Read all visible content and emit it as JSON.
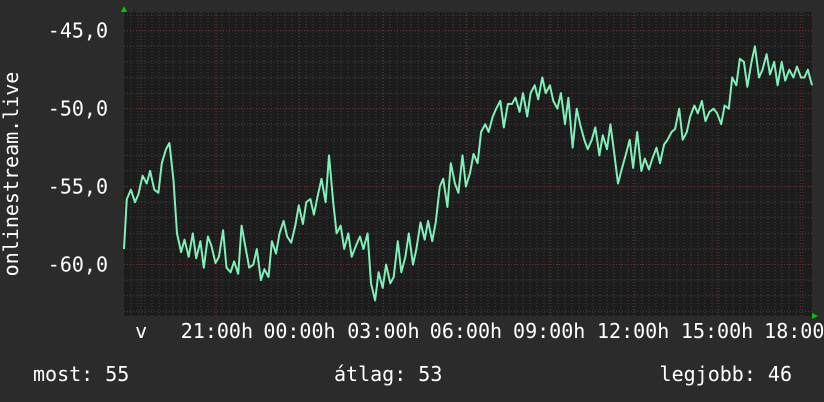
{
  "colors": {
    "background": "#2b2b2b",
    "plot_background": "#1c1c1c",
    "line": "#7ff0b8",
    "grid_minor": "#3e3e3e",
    "grid_major": "#7a2a2a",
    "axis_arrow": "#00c800"
  },
  "stats": {
    "now_label": "most:",
    "now_value": "55",
    "avg_label": "átlag:",
    "avg_value": "53",
    "best_label": "legjobb:",
    "best_value": "46"
  },
  "chart_data": {
    "type": "line",
    "ylabel": "onlinestream.live",
    "ylim": [
      -63.3,
      -43.8
    ],
    "yticks": [
      -45,
      -50,
      -55,
      -60
    ],
    "ytick_labels": [
      "-45,0",
      "-50,0",
      "-55,0",
      "-60,0"
    ],
    "xlim": [
      0,
      100
    ],
    "x_tick_labels": [
      {
        "x": 2.5,
        "label": "v"
      },
      {
        "x": 13.5,
        "label": "21:00h"
      },
      {
        "x": 25.5,
        "label": "00:00h"
      },
      {
        "x": 37.7,
        "label": "03:00h"
      },
      {
        "x": 49.7,
        "label": "06:00h"
      },
      {
        "x": 61.8,
        "label": "09:00h"
      },
      {
        "x": 74.0,
        "label": "12:00h"
      },
      {
        "x": 86.2,
        "label": "15:00h"
      },
      {
        "x": 98.3,
        "label": "18:00h"
      }
    ],
    "grid": true,
    "series": [
      {
        "values": [
          [
            0.0,
            -59.0
          ],
          [
            0.4,
            -55.8
          ],
          [
            1.0,
            -55.2
          ],
          [
            1.6,
            -56.0
          ],
          [
            2.1,
            -55.5
          ],
          [
            2.7,
            -54.3
          ],
          [
            3.3,
            -54.8
          ],
          [
            3.8,
            -54.0
          ],
          [
            4.4,
            -55.2
          ],
          [
            5.0,
            -55.4
          ],
          [
            5.5,
            -53.5
          ],
          [
            6.1,
            -52.6
          ],
          [
            6.6,
            -52.2
          ],
          [
            7.2,
            -54.6
          ],
          [
            7.7,
            -58.0
          ],
          [
            8.3,
            -59.2
          ],
          [
            8.8,
            -58.4
          ],
          [
            9.4,
            -59.5
          ],
          [
            10.0,
            -58.0
          ],
          [
            10.5,
            -59.6
          ],
          [
            11.1,
            -58.5
          ],
          [
            11.6,
            -60.2
          ],
          [
            12.2,
            -58.2
          ],
          [
            12.7,
            -58.8
          ],
          [
            13.3,
            -59.9
          ],
          [
            13.8,
            -59.5
          ],
          [
            14.4,
            -57.8
          ],
          [
            14.9,
            -60.2
          ],
          [
            15.5,
            -60.5
          ],
          [
            16.0,
            -59.8
          ],
          [
            16.6,
            -60.6
          ],
          [
            17.1,
            -57.5
          ],
          [
            17.7,
            -59.0
          ],
          [
            18.2,
            -60.2
          ],
          [
            18.8,
            -60.0
          ],
          [
            19.3,
            -59.0
          ],
          [
            19.9,
            -61.0
          ],
          [
            20.4,
            -60.3
          ],
          [
            21.0,
            -60.8
          ],
          [
            21.5,
            -58.5
          ],
          [
            22.1,
            -59.3
          ],
          [
            22.6,
            -58.0
          ],
          [
            23.2,
            -57.2
          ],
          [
            23.7,
            -58.2
          ],
          [
            24.3,
            -58.6
          ],
          [
            24.9,
            -57.5
          ],
          [
            25.4,
            -56.2
          ],
          [
            26.0,
            -57.4
          ],
          [
            26.5,
            -56.0
          ],
          [
            27.1,
            -55.8
          ],
          [
            27.6,
            -56.8
          ],
          [
            28.2,
            -55.5
          ],
          [
            28.7,
            -54.5
          ],
          [
            29.3,
            -56.0
          ],
          [
            29.8,
            -53.0
          ],
          [
            30.4,
            -56.0
          ],
          [
            30.9,
            -58.0
          ],
          [
            31.5,
            -57.5
          ],
          [
            32.0,
            -59.0
          ],
          [
            32.6,
            -58.0
          ],
          [
            33.1,
            -59.5
          ],
          [
            33.7,
            -58.8
          ],
          [
            34.3,
            -58.2
          ],
          [
            34.8,
            -59.0
          ],
          [
            35.4,
            -58.0
          ],
          [
            35.9,
            -61.2
          ],
          [
            36.5,
            -62.3
          ],
          [
            37.0,
            -60.5
          ],
          [
            37.6,
            -61.5
          ],
          [
            38.1,
            -60.0
          ],
          [
            38.7,
            -61.2
          ],
          [
            39.2,
            -60.8
          ],
          [
            39.8,
            -58.5
          ],
          [
            40.3,
            -60.5
          ],
          [
            40.9,
            -59.5
          ],
          [
            41.4,
            -58.0
          ],
          [
            42.0,
            -60.0
          ],
          [
            42.5,
            -59.0
          ],
          [
            43.1,
            -57.3
          ],
          [
            43.7,
            -58.4
          ],
          [
            44.2,
            -57.2
          ],
          [
            44.8,
            -58.5
          ],
          [
            45.3,
            -57.3
          ],
          [
            45.9,
            -55.0
          ],
          [
            46.4,
            -54.5
          ],
          [
            47.0,
            -56.3
          ],
          [
            47.5,
            -53.5
          ],
          [
            48.1,
            -54.8
          ],
          [
            48.6,
            -55.4
          ],
          [
            49.2,
            -53.0
          ],
          [
            49.7,
            -55.0
          ],
          [
            50.3,
            -54.1
          ],
          [
            50.8,
            -52.9
          ],
          [
            51.4,
            -53.5
          ],
          [
            51.9,
            -51.5
          ],
          [
            52.5,
            -51.0
          ],
          [
            53.0,
            -51.5
          ],
          [
            53.6,
            -50.5
          ],
          [
            54.1,
            -50.0
          ],
          [
            54.7,
            -49.5
          ],
          [
            55.2,
            -51.2
          ],
          [
            55.8,
            -49.7
          ],
          [
            56.4,
            -49.7
          ],
          [
            56.9,
            -49.3
          ],
          [
            57.5,
            -50.2
          ],
          [
            58.0,
            -49.0
          ],
          [
            58.6,
            -50.5
          ],
          [
            59.1,
            -49.0
          ],
          [
            59.7,
            -48.5
          ],
          [
            60.2,
            -49.4
          ],
          [
            60.8,
            -48.0
          ],
          [
            61.3,
            -49.0
          ],
          [
            61.9,
            -48.5
          ],
          [
            62.4,
            -49.5
          ],
          [
            63.0,
            -50.0
          ],
          [
            63.5,
            -49.0
          ],
          [
            64.1,
            -51.0
          ],
          [
            64.6,
            -49.3
          ],
          [
            65.2,
            -52.5
          ],
          [
            65.8,
            -50.0
          ],
          [
            66.3,
            -51.0
          ],
          [
            66.9,
            -52.0
          ],
          [
            67.4,
            -52.6
          ],
          [
            68.0,
            -52.0
          ],
          [
            68.5,
            -51.2
          ],
          [
            69.1,
            -53.0
          ],
          [
            69.6,
            -51.7
          ],
          [
            70.2,
            -52.6
          ],
          [
            70.7,
            -51.0
          ],
          [
            71.3,
            -53.0
          ],
          [
            71.8,
            -54.8
          ],
          [
            72.4,
            -53.8
          ],
          [
            72.9,
            -53.0
          ],
          [
            73.5,
            -52.0
          ],
          [
            74.0,
            -53.8
          ],
          [
            74.6,
            -51.5
          ],
          [
            75.2,
            -54.0
          ],
          [
            75.7,
            -53.2
          ],
          [
            76.3,
            -53.9
          ],
          [
            76.8,
            -53.2
          ],
          [
            77.4,
            -52.5
          ],
          [
            77.9,
            -53.5
          ],
          [
            78.5,
            -52.3
          ],
          [
            79.0,
            -52.0
          ],
          [
            79.6,
            -51.5
          ],
          [
            80.1,
            -51.3
          ],
          [
            80.7,
            -50.0
          ],
          [
            81.2,
            -52.0
          ],
          [
            81.8,
            -51.5
          ],
          [
            82.3,
            -50.5
          ],
          [
            82.9,
            -49.8
          ],
          [
            83.4,
            -50.3
          ],
          [
            84.0,
            -49.5
          ],
          [
            84.5,
            -50.8
          ],
          [
            85.1,
            -50.2
          ],
          [
            85.7,
            -50.0
          ],
          [
            86.2,
            -50.3
          ],
          [
            86.8,
            -51.0
          ],
          [
            87.3,
            -49.8
          ],
          [
            87.9,
            -50.0
          ],
          [
            88.4,
            -48.0
          ],
          [
            89.0,
            -48.5
          ],
          [
            89.5,
            -46.8
          ],
          [
            90.1,
            -47.0
          ],
          [
            90.6,
            -48.6
          ],
          [
            91.2,
            -47.0
          ],
          [
            91.7,
            -46.0
          ],
          [
            92.3,
            -48.0
          ],
          [
            92.8,
            -47.5
          ],
          [
            93.4,
            -46.5
          ],
          [
            93.9,
            -47.8
          ],
          [
            94.5,
            -47.0
          ],
          [
            95.0,
            -48.5
          ],
          [
            95.6,
            -47.0
          ],
          [
            96.1,
            -48.2
          ],
          [
            96.7,
            -47.5
          ],
          [
            97.3,
            -48.0
          ],
          [
            97.8,
            -47.3
          ],
          [
            98.4,
            -48.0
          ],
          [
            98.9,
            -48.0
          ],
          [
            99.4,
            -47.5
          ],
          [
            99.7,
            -48.0
          ],
          [
            100.0,
            -48.5
          ]
        ]
      }
    ]
  }
}
